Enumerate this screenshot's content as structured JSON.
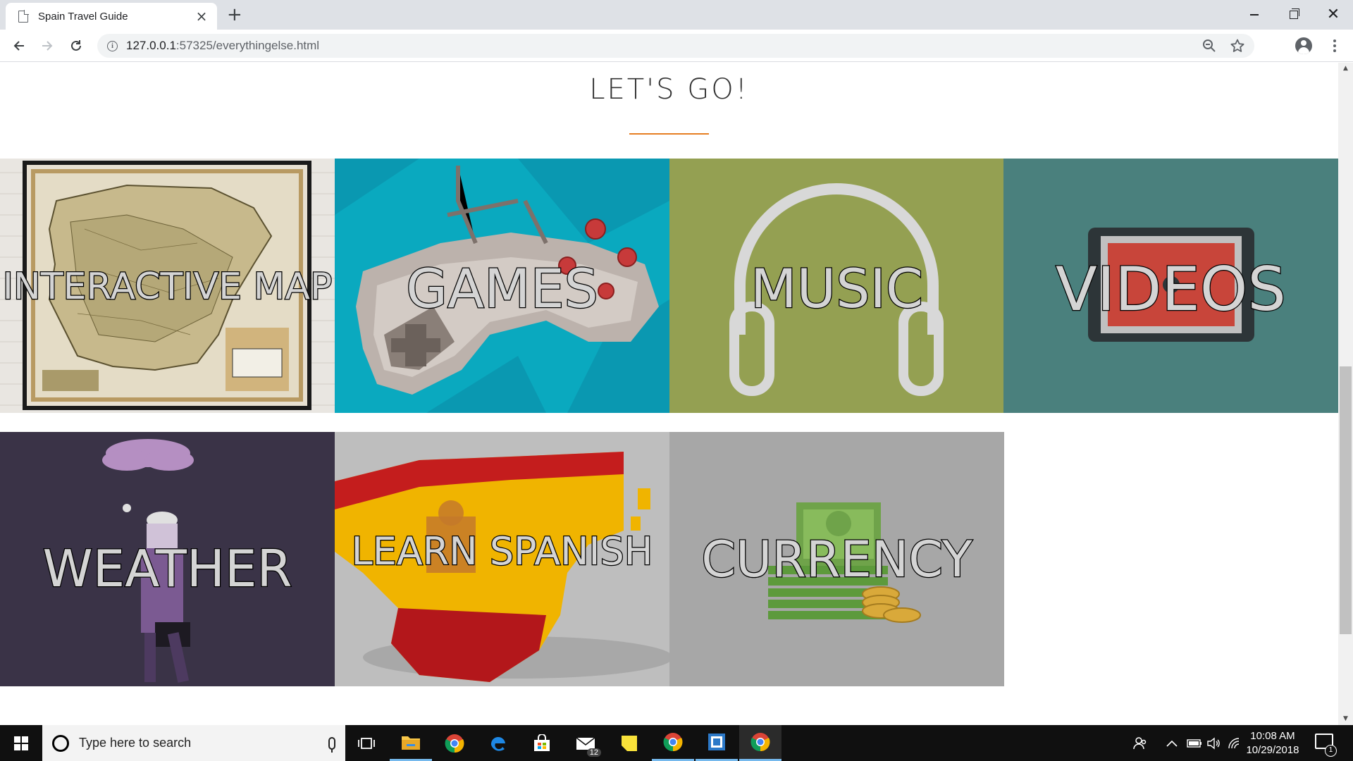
{
  "browser": {
    "tab_title": "Spain Travel Guide",
    "tab_close": "×",
    "new_tab": "+",
    "url_host": "127.0.0.1",
    "url_rest": ":57325/everythingelse.html",
    "back_icon": "arrow-back-icon",
    "forward_icon": "arrow-forward-icon",
    "reload_icon": "reload-icon"
  },
  "page": {
    "heading": "LET'S GO!",
    "accent_color": "#e67e22",
    "tiles": [
      {
        "label": "INTERACTIVE MAP",
        "bg": "#e8e4de"
      },
      {
        "label": "GAMES",
        "bg": "#0aa9bf"
      },
      {
        "label": "MUSIC",
        "bg": "#94a052"
      },
      {
        "label": "VIDEOS",
        "bg": "#4a807d"
      },
      {
        "label": "WEATHER",
        "bg": "#3a3347"
      },
      {
        "label": "LEARN SPANISH",
        "bg": "#bcbcbc"
      },
      {
        "label": "CURRENCY",
        "bg": "#a7a7a7"
      }
    ]
  },
  "taskbar": {
    "search_placeholder": "Type here to search",
    "mail_badge": "12",
    "time": "10:08 AM",
    "date": "10/29/2018",
    "notification_count": "1"
  }
}
